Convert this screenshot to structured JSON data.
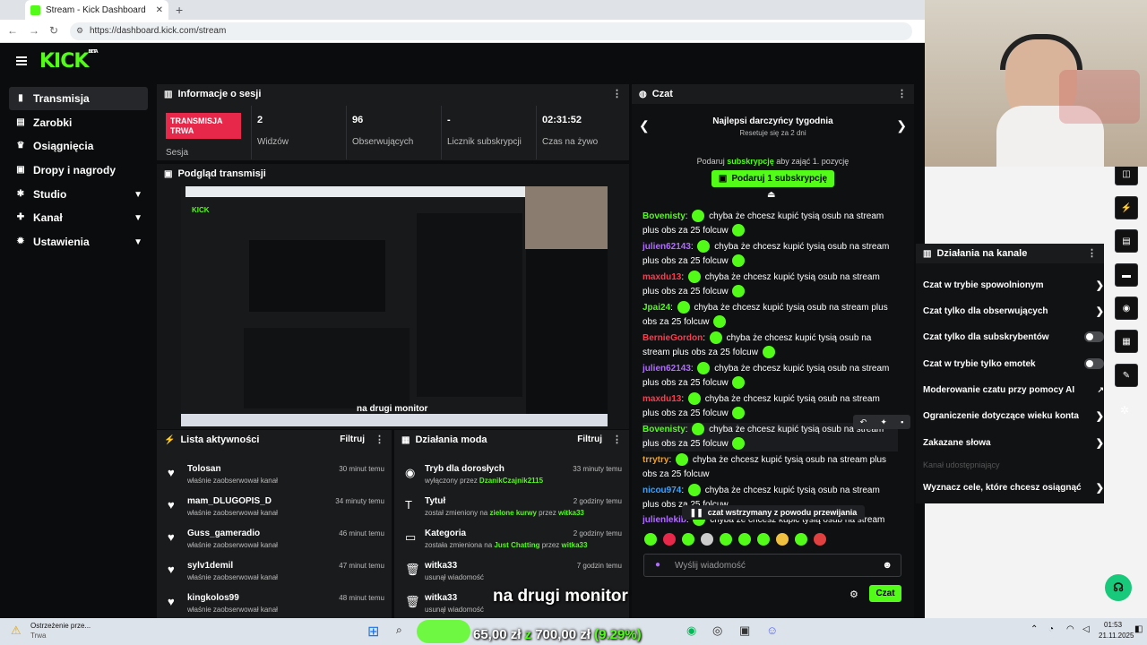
{
  "browser": {
    "tab_title": "Stream - Kick Dashboard",
    "tab_close": "✕",
    "new_tab": "+",
    "url": "https://dashboard.kick.com/stream"
  },
  "logo": {
    "text": "KICK",
    "badge": "BETA"
  },
  "sidebar": {
    "items": [
      {
        "label": "Transmisja",
        "icon": "broadcast-icon",
        "active": true
      },
      {
        "label": "Zarobki",
        "icon": "earnings-icon"
      },
      {
        "label": "Osiągnięcia",
        "icon": "trophy-icon"
      },
      {
        "label": "Dropy i nagrody",
        "icon": "gift-icon"
      },
      {
        "label": "Studio",
        "icon": "studio-icon",
        "expandable": true
      },
      {
        "label": "Kanał",
        "icon": "channel-icon",
        "expandable": true
      },
      {
        "label": "Ustawienia",
        "icon": "settings-icon",
        "expandable": true
      }
    ]
  },
  "session": {
    "title": "Informacje o sesji",
    "live_badge": "TRANSMISJA TRWA",
    "session_label": "Sesja",
    "stats": [
      {
        "value": "2",
        "label": "Widzów"
      },
      {
        "value": "96",
        "label": "Obserwujących"
      },
      {
        "value": "-",
        "label": "Licznik subskrypcji"
      },
      {
        "value": "02:31:52",
        "label": "Czas na żywo"
      }
    ]
  },
  "preview": {
    "title": "Podgląd transmisji",
    "caption": "na drugi monitor"
  },
  "activity": {
    "title": "Lista aktywności",
    "filter": "Filtruj",
    "items": [
      {
        "name": "Tolosan",
        "sub": "właśnie zaobserwował kanał",
        "time": "30 minut temu"
      },
      {
        "name": "mam_DLUGOPIS_D",
        "sub": "właśnie zaobserwował kanał",
        "time": "34 minuty temu"
      },
      {
        "name": "Guss_gameradio",
        "sub": "właśnie zaobserwował kanał",
        "time": "46 minut temu"
      },
      {
        "name": "sylv1demil",
        "sub": "właśnie zaobserwował kanał",
        "time": "47 minut temu"
      },
      {
        "name": "kingkolos99",
        "sub": "właśnie zaobserwował kanał",
        "time": "48 minut temu"
      }
    ]
  },
  "mod": {
    "title": "Działania moda",
    "filter": "Filtruj",
    "items": [
      {
        "name": "Tryb dla dorosłych",
        "pre": "wyłączony przez ",
        "hl1": "DzanikCzajnik2115",
        "mid": "",
        "hl2": "",
        "post": "",
        "time": "33 minuty temu",
        "icon": "eye-icon"
      },
      {
        "name": "Tytuł",
        "pre": "został zmieniony na ",
        "hl1": "zielone kurwy",
        "mid": " przez ",
        "hl2": "witka33",
        "post": "",
        "time": "2 godziny temu",
        "icon": "text-icon"
      },
      {
        "name": "Kategoria",
        "pre": "została zmieniona na ",
        "hl1": "Just Chatting",
        "mid": " przez ",
        "hl2": "witka33",
        "post": "",
        "time": "2 godziny temu",
        "icon": "category-icon"
      },
      {
        "name": "witka33",
        "pre": "usunął wiadomość",
        "hl1": "",
        "mid": "",
        "hl2": "",
        "post": "",
        "time": "7 godzin temu",
        "icon": "trash-icon"
      },
      {
        "name": "witka33",
        "pre": "usunął wiadomość",
        "hl1": "",
        "mid": "",
        "hl2": "",
        "post": "",
        "time": "7 godzin temu",
        "icon": "trash-icon"
      }
    ]
  },
  "chat": {
    "title": "Czat",
    "top_gifters_title": "Najlepsi darczyńcy tygodnia",
    "top_gifters_sub": "Resetuje się za 2 dni",
    "gift_prompt_pre": "Podaruj",
    "gift_prompt_hl": "subskrypcję",
    "gift_prompt_post": "aby zająć 1. pozycję",
    "gift_button": "Podaruj 1 subskrypcję",
    "messages": [
      {
        "user": "Bovenisty",
        "color": "#53fc18",
        "text": "chyba że chcesz kupić tysią osub na stream plus obs za 25 folcuw"
      },
      {
        "user": "julien62143",
        "color": "#b06cff",
        "text": "chyba że chcesz kupić tysią osub na stream plus obs za 25 folcuw"
      },
      {
        "user": "maxdu13",
        "color": "#ff3b4e",
        "text": "chyba że chcesz kupić tysią osub na stream plus obs za 25 folcuw"
      },
      {
        "user": "Jpai24",
        "color": "#53fc18",
        "text": "chyba że chcesz kupić tysią osub na stream plus obs za 25 folcuw"
      },
      {
        "user": "BernieGordon",
        "color": "#ff3b4e",
        "text": "chyba że chcesz kupić tysią osub na stream plus obs za 25 folcuw"
      },
      {
        "user": "julien62143",
        "color": "#b06cff",
        "text": "chyba że chcesz kupić tysią osub na stream plus obs za 25 folcuw"
      },
      {
        "user": "maxdu13",
        "color": "#ff3b4e",
        "text": "chyba że chcesz kupić tysią osub na stream plus obs za 25 folcuw"
      },
      {
        "user": "Bovenisty",
        "color": "#53fc18",
        "text": "chyba że chcesz kupić tysią osub na stream plus obs za 25 folcuw"
      },
      {
        "user": "trrytry",
        "color": "#f0a020",
        "text": "chyba że chcesz kupić tysią osub na stream plus obs za 25 folcuw"
      },
      {
        "user": "nicou974",
        "color": "#3aa3ff",
        "text": "chyba że chcesz kupić tysią osub na stream plus obs za 25 folcuw"
      },
      {
        "user": "julienlekib",
        "color": "#b06cff",
        "text": "chyba że chcesz kupić tysią osub na stream plus"
      }
    ],
    "paused_notice": "czat wstrzymany z powodu przewijania",
    "input_placeholder": "Wyślij wiadomość",
    "send_button": "Czat"
  },
  "channel_actions": {
    "title": "Działania na kanale",
    "items": [
      {
        "label": "Czat w trybie spowolnionym",
        "kind": "chevron"
      },
      {
        "label": "Czat tylko dla obserwujących",
        "kind": "chevron"
      },
      {
        "label": "Czat tylko dla subskrybentów",
        "kind": "toggle"
      },
      {
        "label": "Czat w trybie tylko emotek",
        "kind": "toggle"
      },
      {
        "label": "Moderowanie czatu przy pomocy AI",
        "kind": "external"
      },
      {
        "label": "Ograniczenie dotyczące wieku konta",
        "kind": "chevron"
      },
      {
        "label": "Zakazane słowa",
        "kind": "chevron"
      }
    ],
    "section_label": "Kanał udostępniający",
    "goal_item": "Wyznacz cele, które chcesz osiągnąć"
  },
  "overlay": {
    "subtitle": "na drugi monitor",
    "goal_current": "65,00 zł",
    "goal_sep": "z",
    "goal_target": "700,00 zł",
    "goal_percent": "(9.29%)"
  },
  "taskbar": {
    "weather_title": "Ostrzeżenie prze...",
    "weather_sub": "Trwa",
    "time": "01:53",
    "date": "21.11.2025"
  },
  "colors": {
    "accent": "#53fc18",
    "live": "#e8284a",
    "bg": "#0b0c0d",
    "panel": "#1a1b1d"
  }
}
